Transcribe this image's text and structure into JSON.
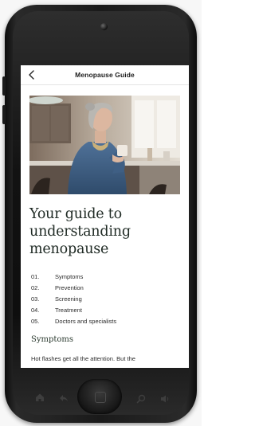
{
  "nav": {
    "title": "Menopause Guide",
    "back_icon": "chevron-left-icon"
  },
  "hero_image": {
    "subject": "woman holding a mug in a kitchen"
  },
  "headline": {
    "line1": "Your guide to",
    "line2": "understanding",
    "line3": "menopause"
  },
  "toc": [
    {
      "num": "01.",
      "label": "Symptoms"
    },
    {
      "num": "02.",
      "label": "Prevention"
    },
    {
      "num": "03.",
      "label": "Screening"
    },
    {
      "num": "04.",
      "label": "Treatment"
    },
    {
      "num": "05.",
      "label": "Doctors and specialists"
    }
  ],
  "section": {
    "title": "Symptoms",
    "body": "Hot flashes get all the attention. But the"
  },
  "device_buttons": {
    "home_icon": "home-icon",
    "back_icon": "back-arrow-icon",
    "search_icon": "search-icon",
    "volume_icon": "speaker-icon"
  },
  "colors": {
    "headline": "#1f2a24",
    "text": "#2b2b2b",
    "screen_bg": "#ffffff",
    "phone_body": "#1a1a1a"
  }
}
